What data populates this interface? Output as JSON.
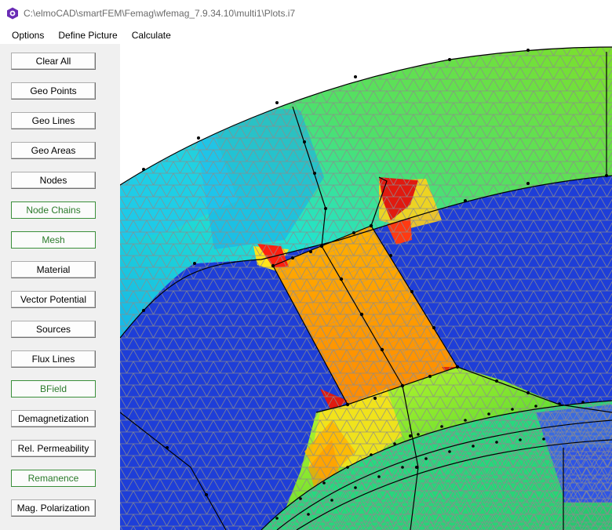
{
  "window": {
    "title": "C:\\elmoCAD\\smartFEM\\Femag\\wfemag_7.9.34.10\\multi1\\Plots.i7",
    "icon": "femag-app-icon"
  },
  "menu": {
    "items": [
      "Options",
      "Define Picture",
      "Calculate"
    ]
  },
  "sidebar": {
    "buttons": [
      {
        "label": "Clear All",
        "active": false
      },
      {
        "label": "Geo Points",
        "active": false
      },
      {
        "label": "Geo Lines",
        "active": false
      },
      {
        "label": "Geo Areas",
        "active": false
      },
      {
        "label": "Nodes",
        "active": false
      },
      {
        "label": "Node Chains",
        "active": true
      },
      {
        "label": "Mesh",
        "active": true
      },
      {
        "label": "Material",
        "active": false
      },
      {
        "label": "Vector Potential",
        "active": false
      },
      {
        "label": "Sources",
        "active": false
      },
      {
        "label": "Flux Lines",
        "active": false
      },
      {
        "label": "BField",
        "active": true
      },
      {
        "label": "Demagnetization",
        "active": false
      },
      {
        "label": "Rel. Permeability",
        "active": false
      },
      {
        "label": "Remanence",
        "active": true
      },
      {
        "label": "Mag. Polarization",
        "active": false
      }
    ]
  },
  "colors": {
    "active_border": "#3a8f3a",
    "active_text": "#2a7a2a",
    "field_low": "#1e3ed8",
    "field_high": "#e01010",
    "mesh_lines": "#8c8c8c",
    "node_chain": "#000000"
  }
}
